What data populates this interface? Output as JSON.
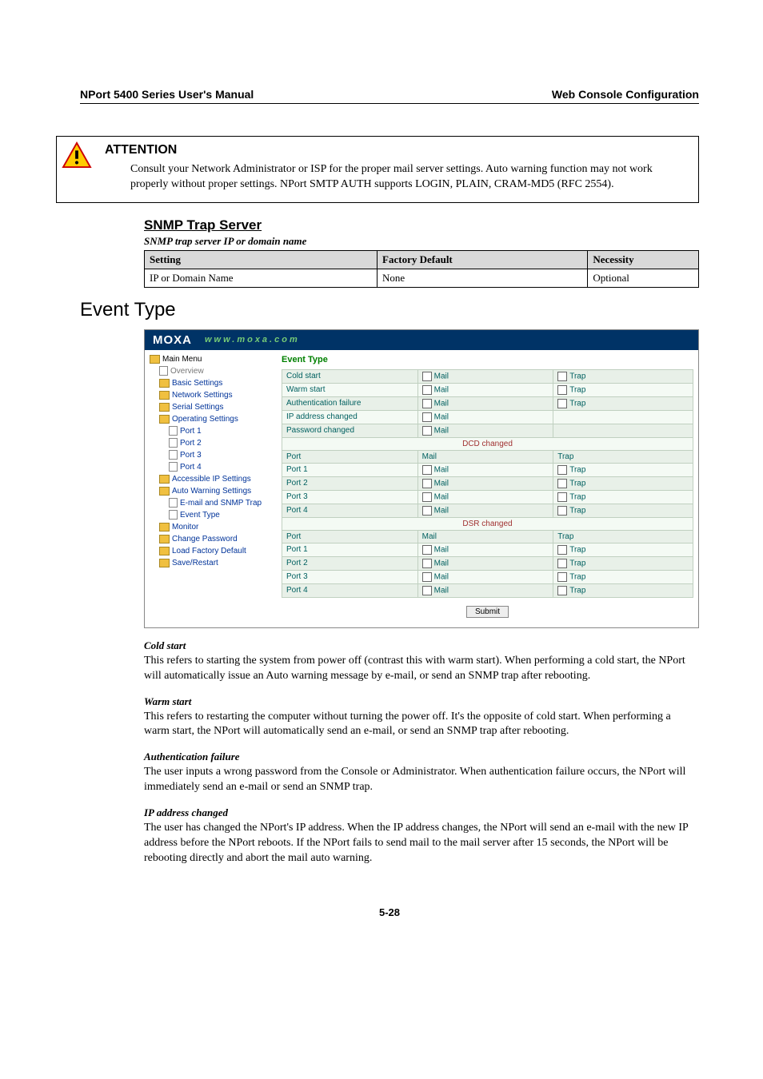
{
  "header": {
    "left": "NPort 5400 Series User's Manual",
    "right": "Web Console Configuration"
  },
  "attention": {
    "title": "ATTENTION",
    "body": "Consult your Network Administrator or ISP for the proper mail server settings. Auto warning function may not work properly without proper settings. NPort SMTP AUTH supports LOGIN, PLAIN, CRAM-MD5 (RFC 2554)."
  },
  "snmp": {
    "heading": "SNMP Trap Server",
    "sub": "SNMP trap server IP or domain name",
    "cols": {
      "setting": "Setting",
      "default": "Factory Default",
      "necessity": "Necessity"
    },
    "row": {
      "setting": "IP or Domain Name",
      "default": "None",
      "necessity": "Optional"
    }
  },
  "event_heading": "Event Type",
  "console": {
    "logo": "MOXA",
    "url": "www.moxa.com",
    "tree": [
      {
        "cls": "folder",
        "label": "Main Menu",
        "indent": 0,
        "link": false
      },
      {
        "cls": "doc",
        "label": "Overview",
        "indent": 1,
        "link": false,
        "gray": true
      },
      {
        "cls": "folder",
        "label": "Basic Settings",
        "indent": 1,
        "link": true
      },
      {
        "cls": "folder",
        "label": "Network Settings",
        "indent": 1,
        "link": true
      },
      {
        "cls": "folder",
        "label": "Serial Settings",
        "indent": 1,
        "link": true
      },
      {
        "cls": "folder",
        "label": "Operating Settings",
        "indent": 1,
        "link": true
      },
      {
        "cls": "doc",
        "label": "Port 1",
        "indent": 2,
        "link": true
      },
      {
        "cls": "doc",
        "label": "Port 2",
        "indent": 2,
        "link": true
      },
      {
        "cls": "doc",
        "label": "Port 3",
        "indent": 2,
        "link": true
      },
      {
        "cls": "doc",
        "label": "Port 4",
        "indent": 2,
        "link": true
      },
      {
        "cls": "folder",
        "label": "Accessible IP Settings",
        "indent": 1,
        "link": true
      },
      {
        "cls": "folder",
        "label": "Auto Warning Settings",
        "indent": 1,
        "link": true
      },
      {
        "cls": "doc",
        "label": "E-mail and SNMP Trap",
        "indent": 2,
        "link": true
      },
      {
        "cls": "doc",
        "label": "Event Type",
        "indent": 2,
        "link": true
      },
      {
        "cls": "folder",
        "label": "Monitor",
        "indent": 1,
        "link": true
      },
      {
        "cls": "folder",
        "label": "Change Password",
        "indent": 1,
        "link": true
      },
      {
        "cls": "folder",
        "label": "Load Factory Default",
        "indent": 1,
        "link": true
      },
      {
        "cls": "folder",
        "label": "Save/Restart",
        "indent": 1,
        "link": true
      }
    ],
    "pane_title": "Event Type",
    "mail_label": "Mail",
    "trap_label": "Trap",
    "port_label": "Port",
    "top_rows": [
      {
        "name": "Cold start",
        "mail": true,
        "trap": true
      },
      {
        "name": "Warm start",
        "mail": true,
        "trap": true
      },
      {
        "name": "Authentication failure",
        "mail": true,
        "trap": true
      },
      {
        "name": "IP address changed",
        "mail": true,
        "trap": false
      },
      {
        "name": "Password changed",
        "mail": true,
        "trap": false
      }
    ],
    "sections": [
      {
        "title": "DCD changed",
        "ports": [
          "Port 1",
          "Port 2",
          "Port 3",
          "Port 4"
        ]
      },
      {
        "title": "DSR changed",
        "ports": [
          "Port 1",
          "Port 2",
          "Port 3",
          "Port 4"
        ]
      }
    ],
    "submit": "Submit"
  },
  "defs": {
    "cold": {
      "h": "Cold start",
      "p": "This refers to starting the system from power off (contrast this with warm start). When performing a cold start, the NPort will automatically issue an Auto warning message by e-mail, or send an SNMP trap after rebooting."
    },
    "warm": {
      "h": "Warm start",
      "p": "This refers to restarting the computer without turning the power off. It's the opposite of cold start. When performing a warm start, the NPort will automatically send an e-mail, or send an SNMP trap after rebooting."
    },
    "auth": {
      "h": "Authentication failure",
      "p": "The user inputs a wrong password from the Console or Administrator. When authentication failure occurs, the NPort will immediately send an e-mail or send an SNMP trap."
    },
    "ip": {
      "h": "IP address changed",
      "p": "The user has changed the NPort's IP address. When the IP address changes, the NPort will send an e-mail with the new IP address before the NPort reboots. If the NPort fails to send mail to the mail server after 15 seconds, the NPort will be rebooting directly and abort the mail auto warning."
    }
  },
  "pagenum": "5-28"
}
